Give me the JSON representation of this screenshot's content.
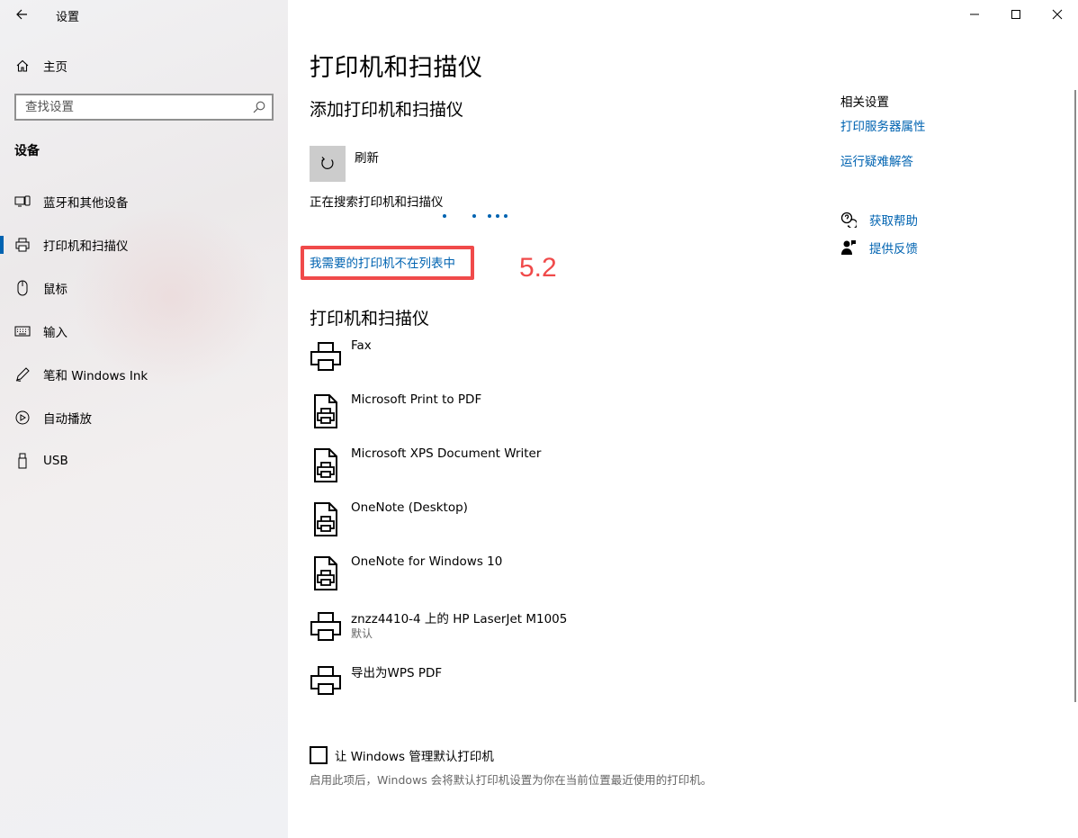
{
  "window": {
    "app_title": "设置",
    "back_icon": "back-arrow-icon",
    "minimize_icon": "minimize-icon",
    "maximize_icon": "maximize-icon",
    "close_icon": "close-icon"
  },
  "sidebar": {
    "home_label": "主页",
    "search_placeholder": "查找设置",
    "section_title": "设备",
    "items": [
      {
        "label": "蓝牙和其他设备",
        "icon": "bluetooth-devices-icon"
      },
      {
        "label": "打印机和扫描仪",
        "icon": "printer-icon",
        "selected": true
      },
      {
        "label": "鼠标",
        "icon": "mouse-icon"
      },
      {
        "label": "输入",
        "icon": "keyboard-icon"
      },
      {
        "label": "笔和 Windows Ink",
        "icon": "pen-icon"
      },
      {
        "label": "自动播放",
        "icon": "autoplay-icon"
      },
      {
        "label": "USB",
        "icon": "usb-icon"
      }
    ]
  },
  "main": {
    "page_title": "打印机和扫描仪",
    "add_heading": "添加打印机和扫描仪",
    "refresh_label": "刷新",
    "searching_text": "正在搜索打印机和扫描仪",
    "not_listed_link": "我需要的打印机不在列表中",
    "annotation_label": "5.2",
    "printers_heading": "打印机和扫描仪",
    "printers": [
      {
        "name": "Fax",
        "sub": "",
        "icon": "printer-icon"
      },
      {
        "name": "Microsoft Print to PDF",
        "sub": "",
        "icon": "virtual-printer-icon"
      },
      {
        "name": "Microsoft XPS Document Writer",
        "sub": "",
        "icon": "virtual-printer-icon"
      },
      {
        "name": "OneNote (Desktop)",
        "sub": "",
        "icon": "virtual-printer-icon"
      },
      {
        "name": "OneNote for Windows 10",
        "sub": "",
        "icon": "virtual-printer-icon"
      },
      {
        "name": "znzz4410-4 上的 HP LaserJet M1005",
        "sub": "默认",
        "icon": "printer-icon"
      },
      {
        "name": "导出为WPS PDF",
        "sub": "",
        "icon": "printer-icon"
      }
    ],
    "default_checkbox_label": "让 Windows 管理默认打印机",
    "default_checkbox_checked": false,
    "hint_text": "启用此项后，Windows 会将默认打印机设置为你在当前位置最近使用的打印机。"
  },
  "related": {
    "title": "相关设置",
    "links": [
      "打印服务器属性",
      "运行疑难解答"
    ],
    "get_help": "获取帮助",
    "feedback": "提供反馈"
  },
  "colors": {
    "accent": "#0063b1",
    "annotation_red": "#f04a4a"
  }
}
